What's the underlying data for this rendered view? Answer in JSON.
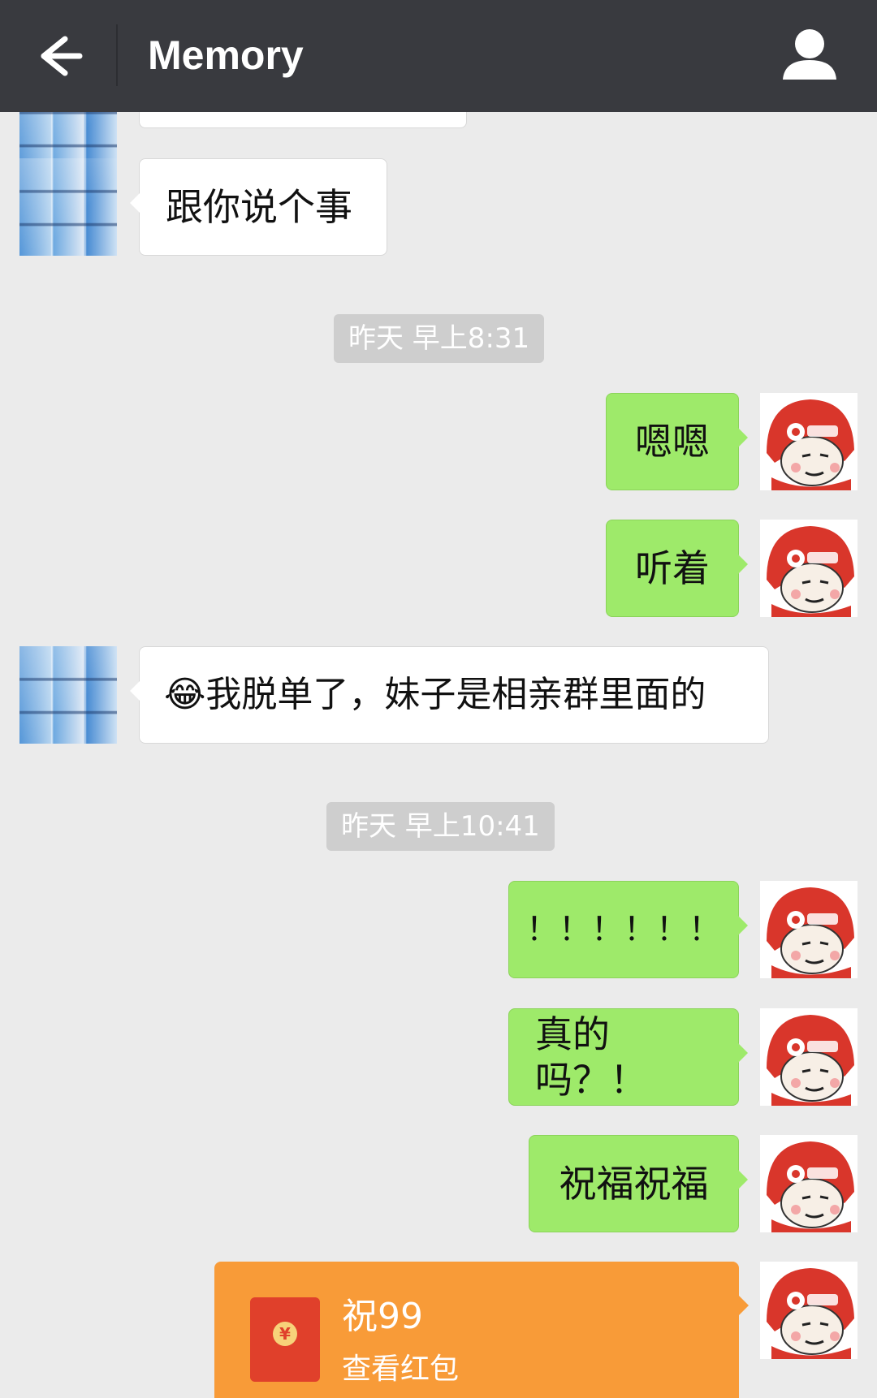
{
  "header": {
    "title": "Memory"
  },
  "messages": [
    {
      "side": "left",
      "text": "跟你说个事"
    },
    {
      "type": "time",
      "text": "昨天 早上8:31"
    },
    {
      "side": "right",
      "text": "嗯嗯"
    },
    {
      "side": "right",
      "text": "听着"
    },
    {
      "side": "left",
      "text": "😂我脱单了，妹子是相亲群里面的"
    },
    {
      "type": "time",
      "text": "昨天 早上10:41"
    },
    {
      "side": "right",
      "text": "！！！！！！"
    },
    {
      "side": "right",
      "text": "真的吗？！"
    },
    {
      "side": "right",
      "text": "祝福祝福"
    }
  ],
  "red_packet": {
    "title": "祝99",
    "subtitle": "查看红包",
    "coin_symbol": "¥"
  },
  "colors": {
    "header_bg": "#393a3f",
    "chat_bg": "#ebebeb",
    "my_bubble": "#9eea6a",
    "their_bubble": "#ffffff",
    "red_packet": "#f89b38"
  },
  "icons": {
    "back": "back-arrow-icon",
    "profile": "person-icon"
  }
}
